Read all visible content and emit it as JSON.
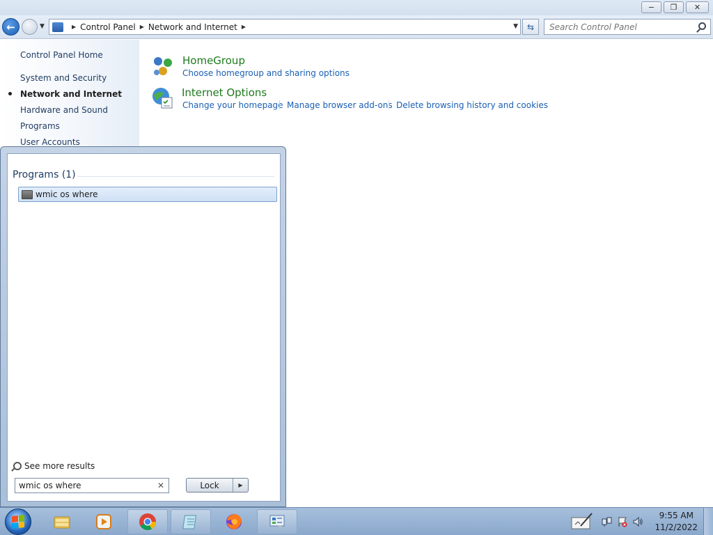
{
  "window": {
    "buttons": {
      "minimize": "minimize-icon",
      "restore": "restore-icon",
      "close": "close-icon"
    }
  },
  "addressbar": {
    "crumbs": [
      "Control Panel",
      "Network and Internet"
    ]
  },
  "search": {
    "placeholder": "Search Control Panel"
  },
  "leftpane": {
    "items": [
      {
        "label": "Control Panel Home"
      },
      {
        "label": "System and Security"
      },
      {
        "label": "Network and Internet",
        "active": true
      },
      {
        "label": "Hardware and Sound"
      },
      {
        "label": "Programs"
      },
      {
        "label": "User Accounts"
      }
    ]
  },
  "categories": [
    {
      "title": "HomeGroup",
      "icon": "homegroup-icon",
      "links": [
        "Choose homegroup and sharing options"
      ]
    },
    {
      "title": "Internet Options",
      "icon": "internet-options-icon",
      "links": [
        "Change your homepage",
        "Manage browser add-ons",
        "Delete browsing history and cookies"
      ]
    }
  ],
  "startmenu": {
    "section_header": "Programs (1)",
    "result": "wmic os where",
    "see_more": "See more results",
    "search_value": "wmic os where",
    "lock_label": "Lock"
  },
  "taskbar": {
    "items": [
      "windows-explorer-icon",
      "media-player-icon",
      "chrome-icon",
      "notepad-icon",
      "firefox-icon",
      "control-panel-icon"
    ],
    "clock_time": "9:55 AM",
    "clock_date": "11/2/2022"
  },
  "colors": {
    "link": "#1a5fb4",
    "category_title": "#1e7a1e",
    "taskbar": "#8aa8cc"
  }
}
